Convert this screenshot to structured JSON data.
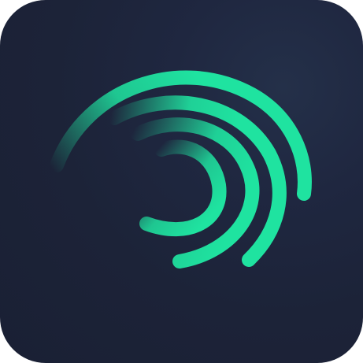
{
  "app_icon": {
    "icon": "alight-motion-swirl-icon",
    "colors": {
      "background": "#1c2338",
      "accent": "#1fe3a0",
      "accent_fade": "#1fe3a0"
    }
  }
}
